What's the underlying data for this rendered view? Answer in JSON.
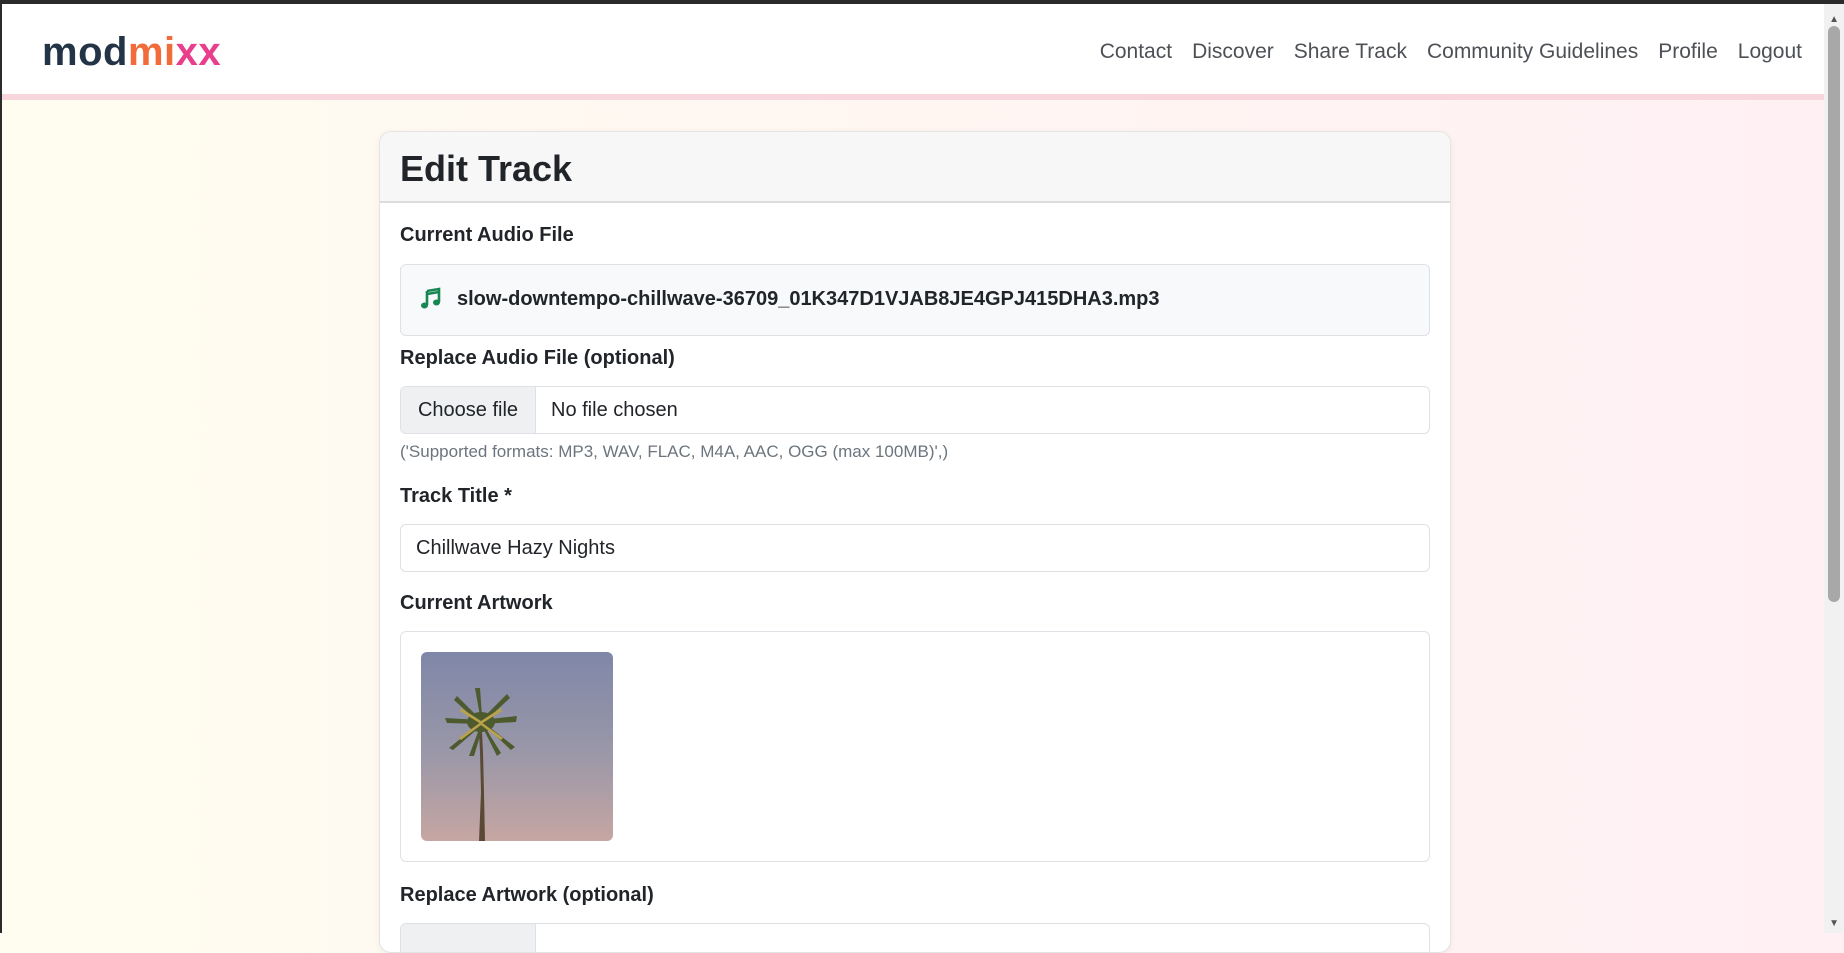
{
  "brand": {
    "part1": "mod",
    "part2": "mi",
    "part3": "xx"
  },
  "nav": {
    "items": [
      "Contact",
      "Discover",
      "Share Track",
      "Community Guidelines",
      "Profile",
      "Logout"
    ]
  },
  "page": {
    "title": "Edit Track"
  },
  "form": {
    "current_audio_label": "Current Audio File",
    "current_audio_filename": "slow-downtempo-chillwave-36709_01K347D1VJAB8JE4GPJ415DHA3.mp3",
    "replace_audio_label": "Replace Audio File (optional)",
    "choose_file_label": "Choose file",
    "no_file_label": "No file chosen",
    "supported_formats": "('Supported formats: MP3, WAV, FLAC, M4A, AAC, OGG (max 100MB)',)",
    "track_title_label": "Track Title *",
    "track_title_value": "Chillwave Hazy Nights",
    "current_artwork_label": "Current Artwork",
    "replace_artwork_label": "Replace Artwork (optional)"
  },
  "colors": {
    "brand_dark": "#243447",
    "brand_orange": "#f26b3a",
    "brand_pink": "#e83e8c",
    "music_icon": "#198754"
  },
  "icons": {
    "audio": "music-note-icon"
  }
}
